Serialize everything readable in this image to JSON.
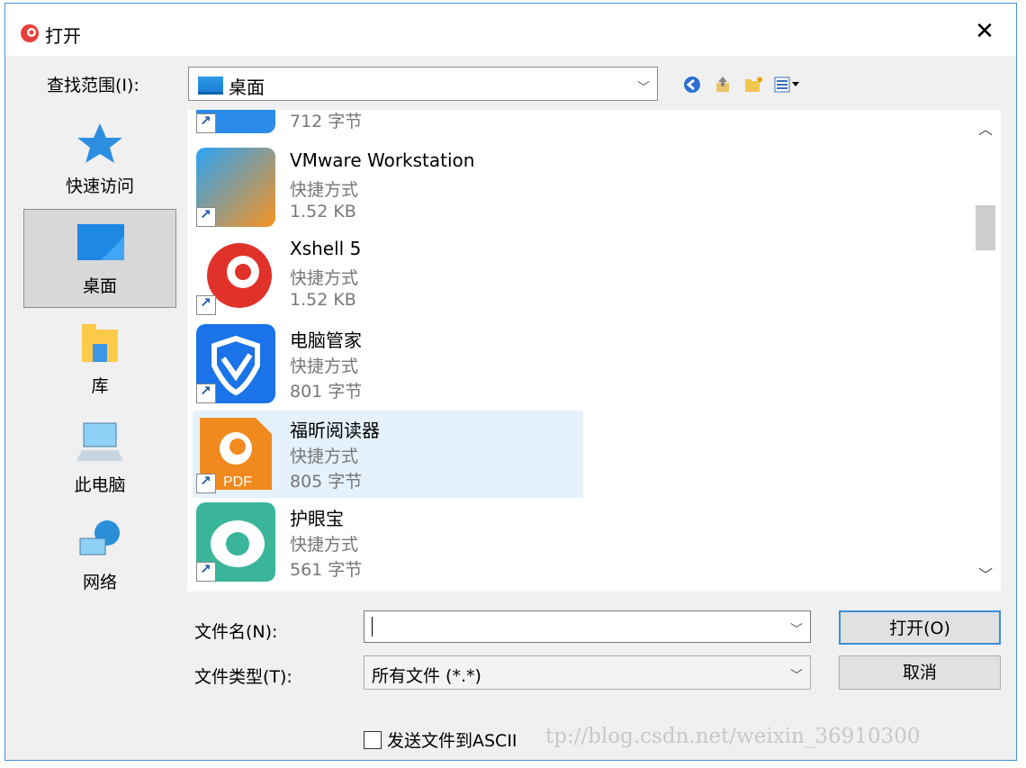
{
  "title": "打开",
  "lookin": {
    "label": "查找范围(I):",
    "value": "桌面"
  },
  "places": [
    {
      "label": "快速访问"
    },
    {
      "label": "桌面"
    },
    {
      "label": "库"
    },
    {
      "label": "此电脑"
    },
    {
      "label": "网络"
    }
  ],
  "files": [
    {
      "size": "712 字节"
    },
    {
      "name": "VMware Workstation",
      "type": "快捷方式",
      "size": "1.52 KB"
    },
    {
      "name": "Xshell 5",
      "type": "快捷方式",
      "size": "1.52 KB"
    },
    {
      "name": "电脑管家",
      "type": "快捷方式",
      "size": "801 字节"
    },
    {
      "name": "福昕阅读器",
      "type": "快捷方式",
      "size": "805 字节"
    },
    {
      "name": "护眼宝",
      "type": "快捷方式",
      "size": "561 字节"
    }
  ],
  "file_name": {
    "label": "文件名(N):",
    "value": ""
  },
  "file_type": {
    "label": "文件类型(T):",
    "value": "所有文件 (*.*)"
  },
  "buttons": {
    "open": "打开(O)",
    "cancel": "取消"
  },
  "checkbox": {
    "label": "发送文件到ASCII"
  },
  "watermark": "tp://blog.csdn.net/weixin_36910300",
  "colors": {
    "accent": "#3c8fd9",
    "selected_item": "#e5f1fb"
  }
}
